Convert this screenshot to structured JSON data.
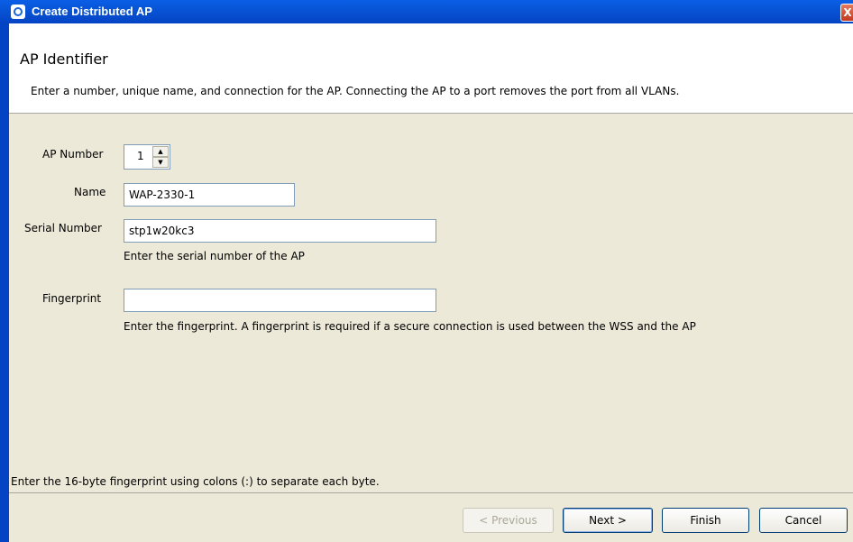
{
  "window": {
    "title": "Create Distributed AP",
    "close_glyph": "X"
  },
  "header": {
    "title": "AP Identifier",
    "description": "Enter a number, unique name, and connection for the AP.  Connecting the AP to a port removes the port from all VLANs."
  },
  "form": {
    "ap_number": {
      "label": "AP Number",
      "value": "1"
    },
    "name": {
      "label": "Name",
      "value": "WAP-2330-1"
    },
    "serial_number": {
      "label": "Serial Number",
      "value": "stp1w20kc3",
      "hint": "Enter the serial number of the AP"
    },
    "fingerprint": {
      "label": "Fingerprint",
      "value": "",
      "hint": "Enter the fingerprint. A fingerprint is required if a secure connection is used between the WSS and the AP"
    }
  },
  "status": {
    "text": "Enter the 16-byte fingerprint using colons (:) to separate each byte."
  },
  "buttons": {
    "previous": "< Previous",
    "next": "Next >",
    "finish": "Finish",
    "cancel": "Cancel"
  },
  "icons": {
    "spin_up": "▲",
    "spin_down": "▼"
  }
}
